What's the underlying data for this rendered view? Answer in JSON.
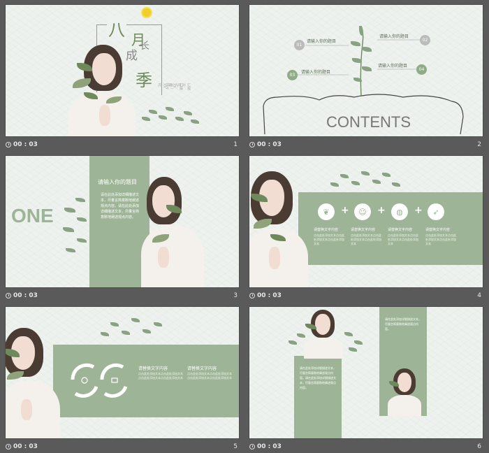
{
  "slides": [
    {
      "num": "1",
      "time": "00 : 03",
      "title_chars": [
        "八",
        "月",
        "成",
        "长",
        "季"
      ],
      "subtitle_lines": [
        "汇报人：豪 / PPT",
        "汇报时间：XX年XX月"
      ]
    },
    {
      "num": "2",
      "time": "00 : 03",
      "heading": "CONTENTS",
      "items": [
        {
          "num": "01",
          "label": "请输入你的题目"
        },
        {
          "num": "02",
          "label": "请输入你的题目"
        },
        {
          "num": "03",
          "label": "请输入你的题目"
        },
        {
          "num": "04",
          "label": "请输入你的题目"
        }
      ]
    },
    {
      "num": "3",
      "time": "00 : 03",
      "big_word": "ONE",
      "panel_title": "请输入你的题目",
      "panel_body": "请在此处添加详细描述文本，尽量言简意赅地阐述观点内容。请在此处添加详细描述文本，尽量言简意赅地阐述观点内容。"
    },
    {
      "num": "4",
      "time": "00 : 03",
      "columns": [
        {
          "title": "请替换文字内容",
          "body": "点击此处添加文本点击此处添加文本点击此处添加文本"
        },
        {
          "title": "请替换文字内容",
          "body": "点击此处添加文本点击此处添加文本点击此处添加文本"
        },
        {
          "title": "请替换文字内容",
          "body": "点击此处添加文本点击此处添加文本点击此处添加文本"
        },
        {
          "title": "请替换文字内容",
          "body": "点击此处添加文本点击此处添加文本点击此处添加文本"
        }
      ]
    },
    {
      "num": "5",
      "time": "00 : 03",
      "columns": [
        {
          "title": "请替换文字内容",
          "body": "点击此处添加文本点击此处添加文本点击此处添加文本点击此处添加文本"
        },
        {
          "title": "请替换文字内容",
          "body": "点击此处添加文本点击此处添加文本点击此处添加文本点击此处添加文本"
        }
      ]
    },
    {
      "num": "6",
      "time": "00 : 03",
      "left_body": "请在此处添加详细描述文本，尽量言简意赅地阐述观点内容。请在此处添加详细描述文本，尽量言简意赅地阐述观点内容。",
      "right_body": "请在此处添加详细描述文本，尽量言简意赅地阐述观点内容。"
    }
  ],
  "colors": {
    "accent": "#9db596",
    "text_green": "#6e8a5c",
    "bg": "#eef2ee",
    "frame": "#5a5a5a"
  },
  "icons": [
    "plant-icon",
    "person-icon",
    "globe-icon",
    "rocket-icon",
    "recycle-arrows-icon"
  ]
}
